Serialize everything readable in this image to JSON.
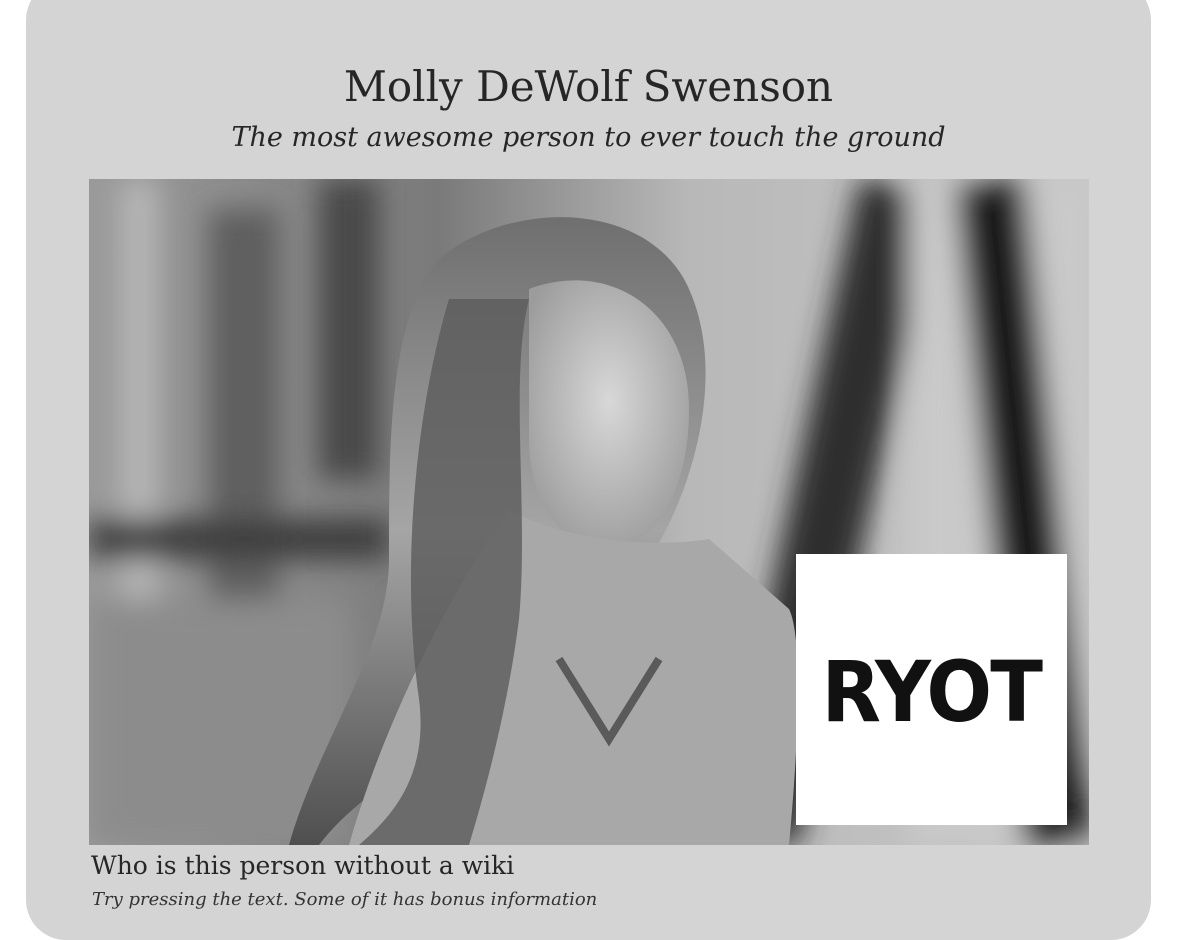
{
  "header": {
    "title": "Molly DeWolf Swenson",
    "subtitle": "The most awesome person to ever touch the ground"
  },
  "photo": {
    "logo_text": "RYOT"
  },
  "section": {
    "heading": "Who is this person without a wiki",
    "hint": "Try pressing the text. Some of it has bonus information"
  },
  "colors": {
    "card_background": "#d4d4d4",
    "text": "#262626"
  }
}
